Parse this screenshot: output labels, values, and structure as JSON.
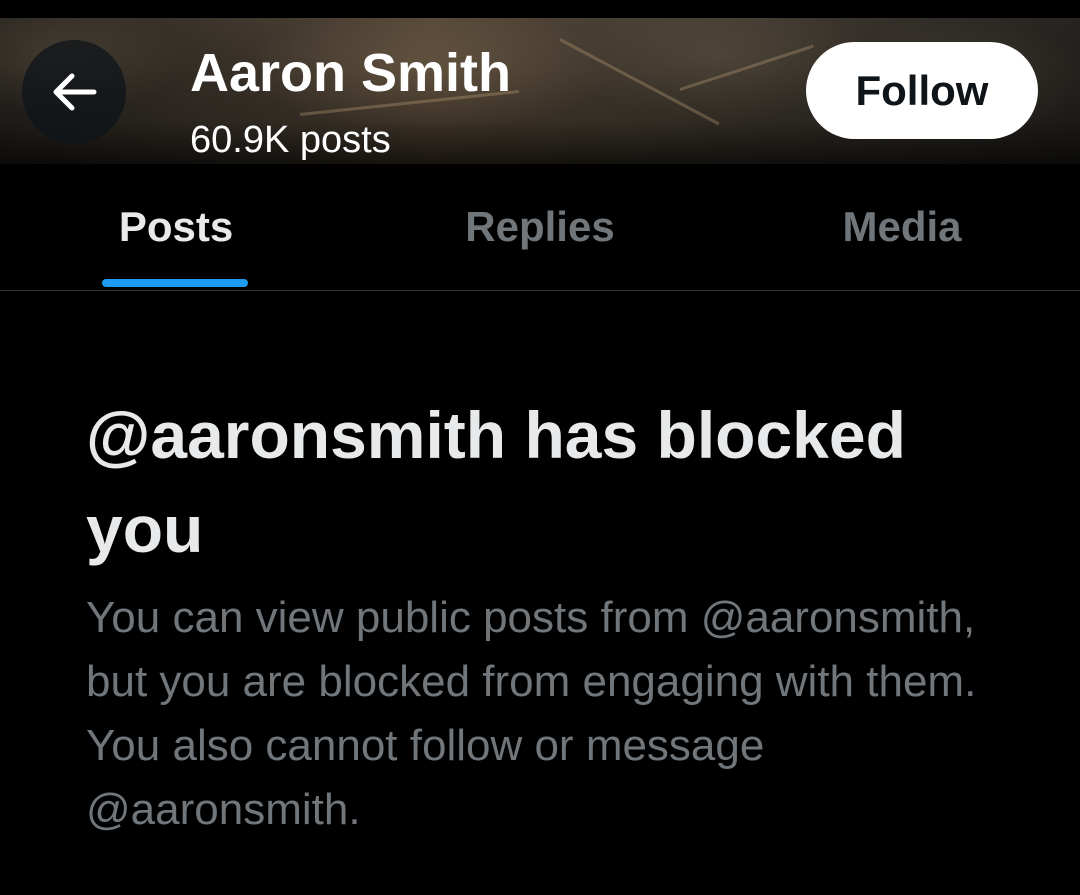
{
  "header": {
    "back_icon": "arrow-left-icon",
    "name": "Aaron Smith",
    "post_count": "60.9K posts",
    "follow_label": "Follow"
  },
  "tabs": [
    {
      "label": "Posts",
      "active": true
    },
    {
      "label": "Replies",
      "active": false
    },
    {
      "label": "Media",
      "active": false
    }
  ],
  "blocked_notice": {
    "title": "@aaronsmith has blocked you",
    "description": "You can view public posts from @aaronsmith, but you are blocked from engaging with them. You also cannot follow or message @aaronsmith."
  },
  "colors": {
    "background": "#000000",
    "primary_text": "#e7e9ea",
    "secondary_text": "#71767b",
    "accent": "#1d9bf0",
    "follow_button_bg": "#ffffff",
    "follow_button_text": "#0f1419",
    "divider": "#2f3336"
  }
}
